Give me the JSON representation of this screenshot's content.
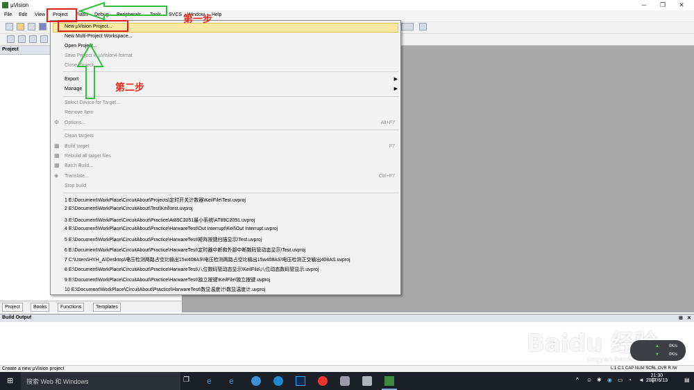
{
  "window": {
    "title": "µVision"
  },
  "menubar": [
    "File",
    "Edit",
    "View",
    "Project",
    "Flash",
    "Debug",
    "Peripherals",
    "Tools",
    "SVCS",
    "Window",
    "Help"
  ],
  "project_pane": {
    "title": "Project"
  },
  "project_tabs": [
    "Project",
    "Books",
    "Functions",
    "Templates"
  ],
  "dropdown": {
    "items": [
      {
        "label": "New µVision Project...",
        "disabled": false
      },
      {
        "label": "New Multi-Project Workspace...",
        "disabled": false
      },
      {
        "label": "Open Project...",
        "disabled": false
      },
      {
        "label": "Save Project in µVision4 format",
        "disabled": true
      },
      {
        "label": "Close Project",
        "disabled": true
      },
      {
        "label": "Export",
        "disabled": false,
        "submenu": true
      },
      {
        "label": "Manage",
        "disabled": false,
        "submenu": true
      },
      {
        "label": "Select Device for Target...",
        "disabled": true
      },
      {
        "label": "Remove Item",
        "disabled": true
      },
      {
        "label": "Options...",
        "disabled": true,
        "shortcut": "Alt+F7"
      },
      {
        "label": "Clean targets",
        "disabled": true
      },
      {
        "label": "Build target",
        "disabled": true,
        "shortcut": "F7"
      },
      {
        "label": "Rebuild all target files",
        "disabled": true
      },
      {
        "label": "Batch Build...",
        "disabled": true
      },
      {
        "label": "Translate...",
        "disabled": true,
        "shortcut": "Ctrl+F7"
      },
      {
        "label": "Stop build",
        "disabled": true
      }
    ],
    "recent": [
      "1 E:\\Document\\WorkPlace\\CircuitAbout\\Projects\\定时开关计数器\\KeilFile\\Test.uvproj",
      "2 E:\\Document\\WorkPlace\\CircuitAbout\\Test\\Keil\\test.uvproj",
      "3 E:\\Document\\WorkPlace\\CircuitAbout\\Practice\\At89C2051最小系统\\AT89C2051.uvproj",
      "4 E:\\Document\\WorkPlace\\CircuitAbout\\Practice\\HarwareTest\\Out interrupt\\Keil\\Out Interrupt.uvproj",
      "5 E:\\Document\\WorkPlace\\CircuitAbout\\Practice\\HarwareTest\\矩阵按键扫描显示\\Test.uvproj",
      "6 E:\\Document\\WorkPlace\\CircuitAbout\\Practice\\HarwareTest\\定时器中断和外部中断数码管动态显示\\Test.uvproj",
      "7 C:\\Users\\HYH_A\\Desktop\\电压检测两路占空比输出15w408AS\\电压检测两路占空比输出15w408AS\\电压检测正交输出408AS.uvproj",
      "8 E:\\Document\\WorkPlace\\CircuitAbout\\Practice\\HarwareTest\\八位数码管动态显示\\KeilFile\\八位动态数码管显示.uvproj",
      "9 E:\\Document\\WorkPlace\\CircuitAbout\\Practice\\HarwareTest\\独立按键\\KeilFile\\独立按键.uvproj",
      "10 E:\\Document\\WorkPlace\\CircuitAbout\\Practice\\HarwareTest\\数显温度计\\数显温度计.uvproj"
    ]
  },
  "annotations": {
    "step1": "第一步",
    "step2": "第二步"
  },
  "build_output": {
    "title": "Build Output"
  },
  "status": {
    "left": "Create a new µVision project",
    "right": "L:1 C:1  CAP  NUM  SCRL  OVR  R /W"
  },
  "taskbar": {
    "search": "搜索 Web 和 Windows",
    "time": "21:30",
    "date": "2017/6/13",
    "ime": "中"
  },
  "watermark": {
    "main": "Baidu 经验",
    "sub": "jingyan.baidu.com"
  },
  "network": {
    "up": "0K/s",
    "down": "0K/s"
  },
  "colors": {
    "annotation_red": "#e22a1a",
    "arrow_green": "#2fbf3a",
    "highlight": "#fde9a0"
  }
}
